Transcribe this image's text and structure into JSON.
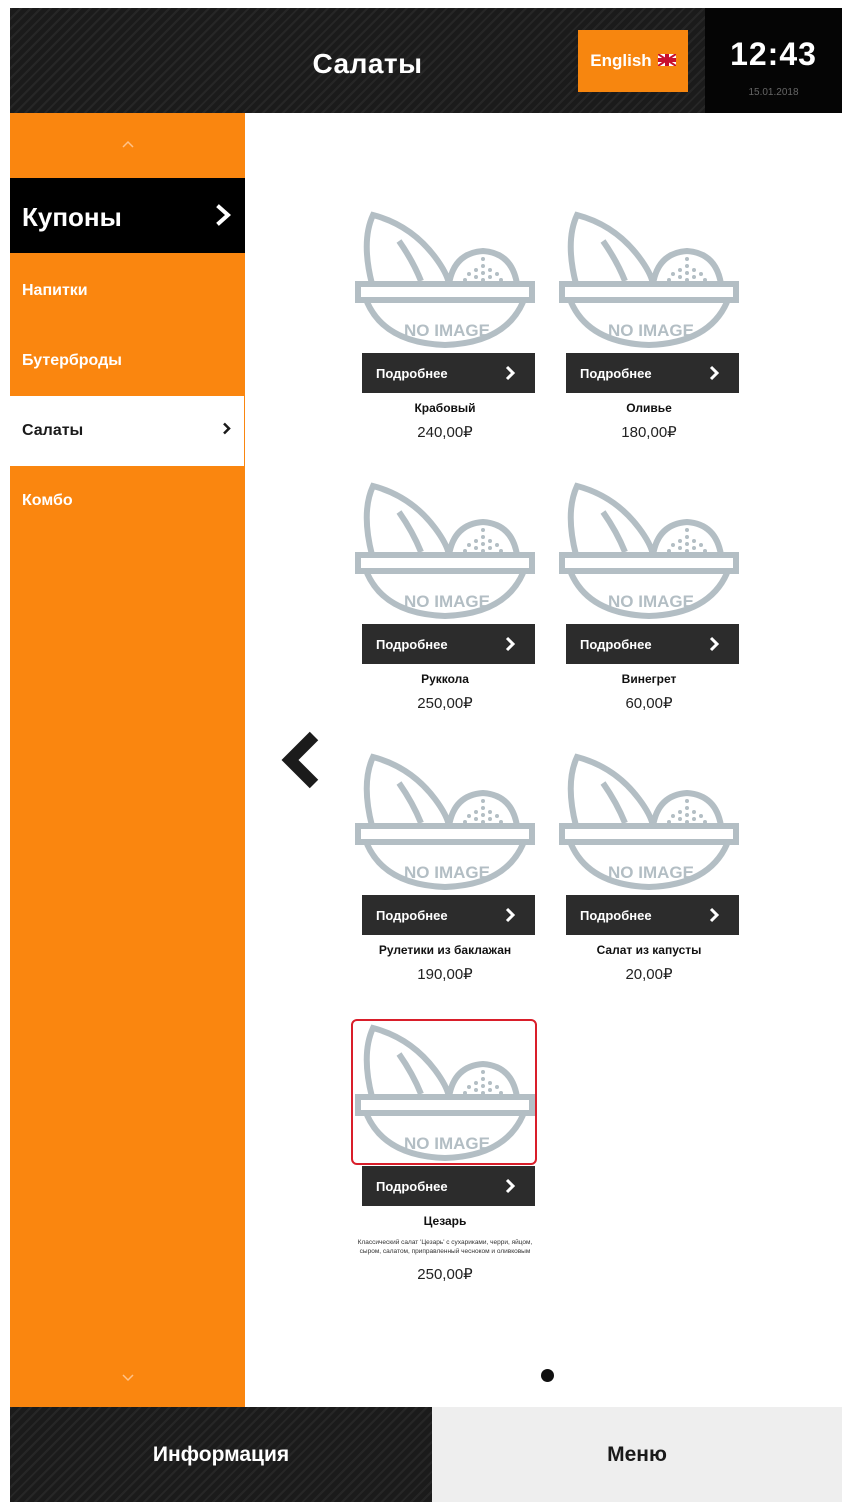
{
  "header": {
    "title": "Салаты",
    "language_button": "English",
    "language_flag_icon": "uk-flag-icon",
    "clock_time": "12:43",
    "clock_date": "15.01.2018"
  },
  "sidebar": {
    "coupons_label": "Купоны",
    "items": [
      {
        "label": "Напитки",
        "active": false
      },
      {
        "label": "Бутерброды",
        "active": false
      },
      {
        "label": "Салаты",
        "active": true
      },
      {
        "label": "Комбо",
        "active": false
      }
    ]
  },
  "products": [
    {
      "name": "Крабовый",
      "price": "240,00₽",
      "button": "Подробнее",
      "placeholder": "NO IMAGE"
    },
    {
      "name": "Оливье",
      "price": "180,00₽",
      "button": "Подробнее",
      "placeholder": "NO IMAGE"
    },
    {
      "name": "Руккола",
      "price": "250,00₽",
      "button": "Подробнее",
      "placeholder": "NO IMAGE"
    },
    {
      "name": "Винегрет",
      "price": "60,00₽",
      "button": "Подробнее",
      "placeholder": "NO IMAGE"
    },
    {
      "name": "Рулетики из баклажан",
      "price": "190,00₽",
      "button": "Подробнее",
      "placeholder": "NO IMAGE"
    },
    {
      "name": "Салат из капусты",
      "price": "20,00₽",
      "button": "Подробнее",
      "placeholder": "NO IMAGE"
    },
    {
      "name": "Цезарь",
      "price": "250,00₽",
      "button": "Подробнее",
      "placeholder": "NO IMAGE",
      "selected": true,
      "description_line1": "Классический салат 'Цезарь'  с сухариками, черри, яйцом,",
      "description_line2": "сыром, салатом, приправленный чесноком и оливковым"
    }
  ],
  "footer": {
    "info_label": "Информация",
    "menu_label": "Меню"
  },
  "colors": {
    "accent": "#fa860f",
    "dark": "#1b1b1b",
    "selection": "#d91e2a",
    "placeholder_gray": "#b3bec4"
  }
}
